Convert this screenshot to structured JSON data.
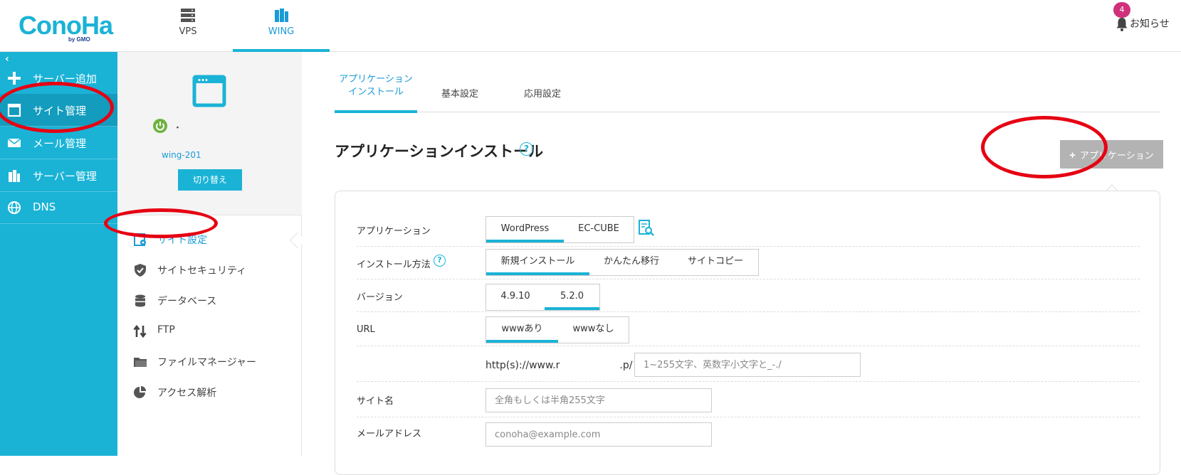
{
  "header": {
    "logo_text": "ConoHa by GMO",
    "tabs": [
      {
        "label": "VPS",
        "icon": "server-stack-icon",
        "active": false
      },
      {
        "label": "WING",
        "icon": "wing-building-icon",
        "active": true
      }
    ],
    "notification_count": "4",
    "notification_label": "お知らせ"
  },
  "leftnav": {
    "collapse_glyph": "‹",
    "items": [
      {
        "label": "サーバー追加",
        "icon": "plus-icon",
        "active": false
      },
      {
        "label": "サイト管理",
        "icon": "window-icon",
        "active": true
      },
      {
        "label": "メール管理",
        "icon": "mail-icon",
        "active": false
      },
      {
        "label": "サーバー管理",
        "icon": "server-icon",
        "active": false
      },
      {
        "label": "DNS",
        "icon": "globe-icon",
        "active": false
      }
    ]
  },
  "subpanel": {
    "server_name_1": "・",
    "server_name_2": "wing-201",
    "switch_label": "切り替え",
    "items": [
      {
        "label": "サイト設定",
        "icon": "site-settings-icon",
        "active": true
      },
      {
        "label": "サイトセキュリティ",
        "icon": "shield-icon",
        "active": false
      },
      {
        "label": "データベース",
        "icon": "database-icon",
        "active": false
      },
      {
        "label": "FTP",
        "icon": "transfer-arrows-icon",
        "active": false
      },
      {
        "label": "ファイルマネージャー",
        "icon": "folder-icon",
        "active": false
      },
      {
        "label": "アクセス解析",
        "icon": "pie-chart-icon",
        "active": false
      }
    ]
  },
  "main": {
    "tabs": [
      {
        "label_line1": "アプリケーション",
        "label_line2": "インストール",
        "active": true
      },
      {
        "label_line1": "基本設定",
        "label_line2": "",
        "active": false
      },
      {
        "label_line1": "応用設定",
        "label_line2": "",
        "active": false
      }
    ],
    "title": "アプリケーションインストール",
    "help_glyph": "?",
    "app_button_label": "アプリケーション",
    "form": {
      "application": {
        "label": "アプリケーション",
        "options": [
          "WordPress",
          "EC-CUBE"
        ],
        "selected": "WordPress"
      },
      "install_method": {
        "label": "インストール方法",
        "options": [
          "新規インストール",
          "かんたん移行",
          "サイトコピー"
        ],
        "selected": "新規インストール"
      },
      "version": {
        "label": "バージョン",
        "options": [
          "4.9.10",
          "5.2.0"
        ],
        "selected": "5.2.0"
      },
      "url": {
        "label": "URL",
        "options": [
          "wwwあり",
          "wwwなし"
        ],
        "selected": "wwwあり"
      },
      "url_prefix": "http(s)://www.r　　　　　　.p/",
      "url_placeholder": "1~255文字、英数字小文字と_-./",
      "site_name": {
        "label": "サイト名",
        "placeholder": "全角もしくは半角255文字"
      },
      "email": {
        "label": "メールアドレス",
        "placeholder": "conoha@example.com"
      }
    }
  },
  "colors": {
    "accent": "#1ab3d6",
    "nav_bg": "#1ab3d6",
    "annotation": "#e60012",
    "badge": "#d0307a"
  }
}
